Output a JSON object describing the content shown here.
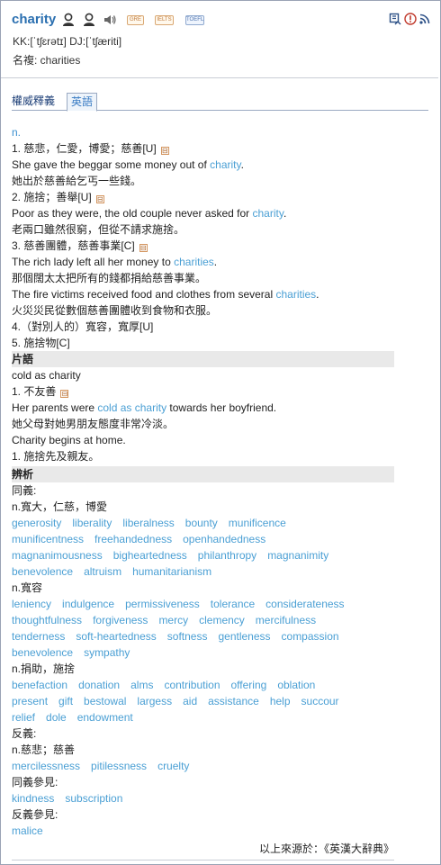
{
  "header": {
    "word": "charity",
    "badges": [
      "GRE",
      "IELTS",
      "TOEFL"
    ],
    "pronunciation": "KK:[ˈtʃɛrətɪ] DJ:[ˈtʃæriti]",
    "plural": "名複: charities"
  },
  "tabs": [
    "權威釋義",
    "英語"
  ],
  "entry": {
    "pos": "n.",
    "senses": [
      {
        "def": "1. 慈悲，仁愛，博愛；慈善[U]",
        "toggle": "⊟",
        "examples": [
          {
            "pre": "She gave the beggar some money out of ",
            "hl": "charity",
            "post": ".",
            "zh": "她出於慈善給乞丐一些錢。"
          }
        ]
      },
      {
        "def": "2. 施捨；善舉[U]",
        "toggle": "⊟",
        "examples": [
          {
            "pre": "Poor as they were, the old couple never asked for ",
            "hl": "charity",
            "post": ".",
            "zh": "老兩口雖然很窮，但從不請求施捨。"
          }
        ]
      },
      {
        "def": "3. 慈善團體，慈善事業[C]",
        "toggle": "⊟",
        "examples": [
          {
            "pre": "The rich lady left all her money to ",
            "hl": "charities",
            "post": ".",
            "zh": "那個闊太太把所有的錢都捐給慈善事業。"
          },
          {
            "pre": "The fire victims received food and clothes from several ",
            "hl": "charities",
            "post": ".",
            "zh": "火災災民從數個慈善團體收到食物和衣服。"
          }
        ]
      },
      {
        "def": "4.（對別人的）寬容，寬厚[U]",
        "toggle": "",
        "examples": []
      },
      {
        "def": "5. 施捨物[C]",
        "toggle": "",
        "examples": []
      }
    ]
  },
  "phrases": {
    "heading": "片語",
    "items": [
      {
        "phrase": "cold as charity",
        "def": "1. 不友善",
        "toggle": "⊟",
        "example": {
          "pre": "Her parents were ",
          "hl": "cold as charity",
          "post": " towards her boyfriend.",
          "zh": "她父母對她男朋友態度非常冷淡。"
        }
      },
      {
        "phrase": "Charity begins at home.",
        "def": "1. 施捨先及親友。"
      }
    ]
  },
  "analysis": {
    "heading": "辨析",
    "synonym_label": "同義:",
    "synonym_groups": [
      {
        "label": "n.寬大，仁慈，博愛",
        "rows": [
          [
            "generosity",
            "liberality",
            "liberalness",
            "bounty",
            "munificence"
          ],
          [
            "munificentness",
            "freehandedness",
            "openhandedness"
          ],
          [
            "magnanimousness",
            "bigheartedness",
            "philanthropy",
            "magnanimity"
          ],
          [
            "benevolence",
            "altruism",
            "humanitarianism"
          ]
        ]
      },
      {
        "label": "n.寬容",
        "rows": [
          [
            "leniency",
            "indulgence",
            "permissiveness",
            "tolerance",
            "considerateness"
          ],
          [
            "thoughtfulness",
            "forgiveness",
            "mercy",
            "clemency",
            "mercifulness"
          ],
          [
            "tenderness",
            "soft-heartedness",
            "softness",
            "gentleness",
            "compassion"
          ],
          [
            "benevolence",
            "sympathy"
          ]
        ]
      },
      {
        "label": "n.捐助，施捨",
        "rows": [
          [
            "benefaction",
            "donation",
            "alms",
            "contribution",
            "offering",
            "oblation"
          ],
          [
            "present",
            "gift",
            "bestowal",
            "largess",
            "aid",
            "assistance",
            "help",
            "succour"
          ],
          [
            "relief",
            "dole",
            "endowment"
          ]
        ]
      }
    ],
    "antonym_label": "反義:",
    "antonym_groups": [
      {
        "label": "n.慈悲；慈善",
        "rows": [
          [
            "mercilessness",
            "pitilessness",
            "cruelty"
          ]
        ]
      }
    ],
    "see_also_synonym_label": "同義參見:",
    "see_also_synonym": [
      "kindness",
      "subscription"
    ],
    "see_also_antonym_label": "反義參見:",
    "see_also_antonym": [
      "malice"
    ],
    "source": "以上來源於：《英漢大辭典》"
  }
}
